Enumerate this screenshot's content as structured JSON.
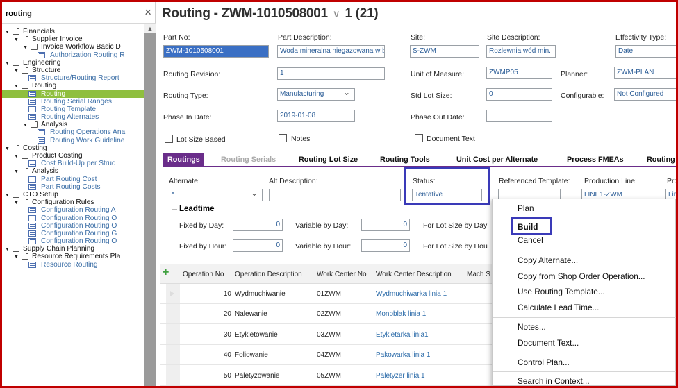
{
  "nav": {
    "search_query": "routing",
    "close_symbol": "×",
    "tree": [
      {
        "label": "Financials",
        "level": 0,
        "kind": "folder"
      },
      {
        "label": "Supplier Invoice",
        "level": 1,
        "kind": "folder"
      },
      {
        "label": "Invoice Workflow Basic D",
        "level": 2,
        "kind": "folder"
      },
      {
        "label": "Authorization Routing R",
        "level": 3,
        "kind": "link"
      },
      {
        "label": "Engineering",
        "level": 0,
        "kind": "folder"
      },
      {
        "label": "Structure",
        "level": 1,
        "kind": "folder"
      },
      {
        "label": "Structure/Routing Report",
        "level": 2,
        "kind": "link"
      },
      {
        "label": "Routing",
        "level": 1,
        "kind": "folder"
      },
      {
        "label": "Routing",
        "level": 2,
        "kind": "link",
        "selected": true
      },
      {
        "label": "Routing Serial Ranges",
        "level": 2,
        "kind": "link"
      },
      {
        "label": "Routing Template",
        "level": 2,
        "kind": "link"
      },
      {
        "label": "Routing Alternates",
        "level": 2,
        "kind": "link"
      },
      {
        "label": "Analysis",
        "level": 2,
        "kind": "folder"
      },
      {
        "label": "Routing Operations Ana",
        "level": 3,
        "kind": "link"
      },
      {
        "label": "Routing Work Guideline",
        "level": 3,
        "kind": "link"
      },
      {
        "label": "Costing",
        "level": 0,
        "kind": "folder"
      },
      {
        "label": "Product Costing",
        "level": 1,
        "kind": "folder"
      },
      {
        "label": "Cost Build-Up per Struc",
        "level": 2,
        "kind": "link"
      },
      {
        "label": "Analysis",
        "level": 1,
        "kind": "folder"
      },
      {
        "label": "Part Routing Cost",
        "level": 2,
        "kind": "link"
      },
      {
        "label": "Part Routing Costs",
        "level": 2,
        "kind": "link"
      },
      {
        "label": "CTO Setup",
        "level": 0,
        "kind": "folder"
      },
      {
        "label": "Configuration Rules",
        "level": 1,
        "kind": "folder"
      },
      {
        "label": "Configuration Routing A",
        "level": 2,
        "kind": "link"
      },
      {
        "label": "Configuration Routing O",
        "level": 2,
        "kind": "link"
      },
      {
        "label": "Configuration Routing O",
        "level": 2,
        "kind": "link"
      },
      {
        "label": "Configuration Routing G",
        "level": 2,
        "kind": "link"
      },
      {
        "label": "Configuration Routing O",
        "level": 2,
        "kind": "link"
      },
      {
        "label": "Supply Chain Planning",
        "level": 0,
        "kind": "folder"
      },
      {
        "label": "Resource Requirements Pla",
        "level": 1,
        "kind": "folder"
      },
      {
        "label": "Resource Routing",
        "level": 2,
        "kind": "link"
      }
    ]
  },
  "header": {
    "title": "Routing - ZWM-1010508001",
    "chevron": "∨",
    "counter": "1 (21)"
  },
  "form": {
    "part_no_label": "Part No:",
    "part_no": "ZWM-1010508001",
    "part_desc_label": "Part Description:",
    "part_desc": "Woda mineralna niegazowana w bu",
    "site_label": "Site:",
    "site": "S-ZWM",
    "site_desc_label": "Site Description:",
    "site_desc": "Rozlewnia wód min.",
    "effectivity_label": "Effectivity Type:",
    "effectivity": "Date",
    "revision_label": "Routing Revision:",
    "revision": "1",
    "uom_label": "Unit of Measure:",
    "uom": "ZWMP05",
    "planner_label": "Planner:",
    "planner": "ZWM-PLAN",
    "type_label": "Routing Type:",
    "type": "Manufacturing",
    "std_lot_label": "Std Lot Size:",
    "std_lot": "0",
    "configurable_label": "Configurable:",
    "configurable": "Not Configured",
    "phase_in_label": "Phase In Date:",
    "phase_in": "2019-01-08",
    "phase_out_label": "Phase Out Date:",
    "phase_out": "",
    "lot_size_based": "Lot Size Based",
    "notes": "Notes",
    "document_text": "Document Text"
  },
  "tabs": [
    "Routings",
    "Routing Serials",
    "Routing Lot Size",
    "Routing Tools",
    "Unit Cost per Alternate",
    "Process FMEAs",
    "Routing I"
  ],
  "panel": {
    "alternate_label": "Alternate:",
    "alternate": "*",
    "alt_desc_label": "Alt Description:",
    "status_label": "Status:",
    "status": "Tentative",
    "ref_template_label": "Referenced Template:",
    "production_line_label": "Production Line:",
    "production_line": "LINE1-ZWM",
    "pro_label": "Pro",
    "pro_value": "Lin",
    "leadtime_title": "Leadtime",
    "fixed_day_label": "Fixed by Day:",
    "fixed_day": "0",
    "variable_day_label": "Variable by Day:",
    "variable_day": "0",
    "lot_day_label": "For Lot Size by Day",
    "fixed_hour_label": "Fixed by Hour:",
    "fixed_hour": "0",
    "variable_hour_label": "Variable by Hour:",
    "variable_hour": "0",
    "lot_hour_label": "For Lot Size by Hou"
  },
  "grid": {
    "add_symbol": "+",
    "columns": [
      "Operation No",
      "Operation Description",
      "Work Center No",
      "Work Center Description",
      "Mach S"
    ],
    "rows": [
      {
        "op": "10",
        "desc": "Wydmuchiwanie",
        "wc": "01ZWM",
        "wcdesc": "Wydmuchiwarka linia 1"
      },
      {
        "op": "20",
        "desc": "Nalewanie",
        "wc": "02ZWM",
        "wcdesc": "Monoblak linia 1"
      },
      {
        "op": "30",
        "desc": "Etykietowanie",
        "wc": "03ZWM",
        "wcdesc": "Etykietarka linia1"
      },
      {
        "op": "40",
        "desc": "Foliowanie",
        "wc": "04ZWM",
        "wcdesc": "Pakowarka linia 1"
      },
      {
        "op": "50",
        "desc": "Paletyzowanie",
        "wc": "05ZWM",
        "wcdesc": "Paletyzer linia 1"
      }
    ]
  },
  "context_menu": {
    "items": [
      "Plan",
      "Build",
      "Cancel",
      "Copy Alternate...",
      "Copy from Shop Order Operation...",
      "Use Routing Template...",
      "Calculate Lead Time...",
      "Notes...",
      "Document Text...",
      "Control Plan...",
      "Search in Context..."
    ]
  },
  "colors": {
    "frame": "#c00000",
    "tab_active": "#6a2d8a",
    "nav_selected": "#8fbf3f",
    "highlight_box": "#3a3ab8",
    "link": "#2a6aa8"
  }
}
